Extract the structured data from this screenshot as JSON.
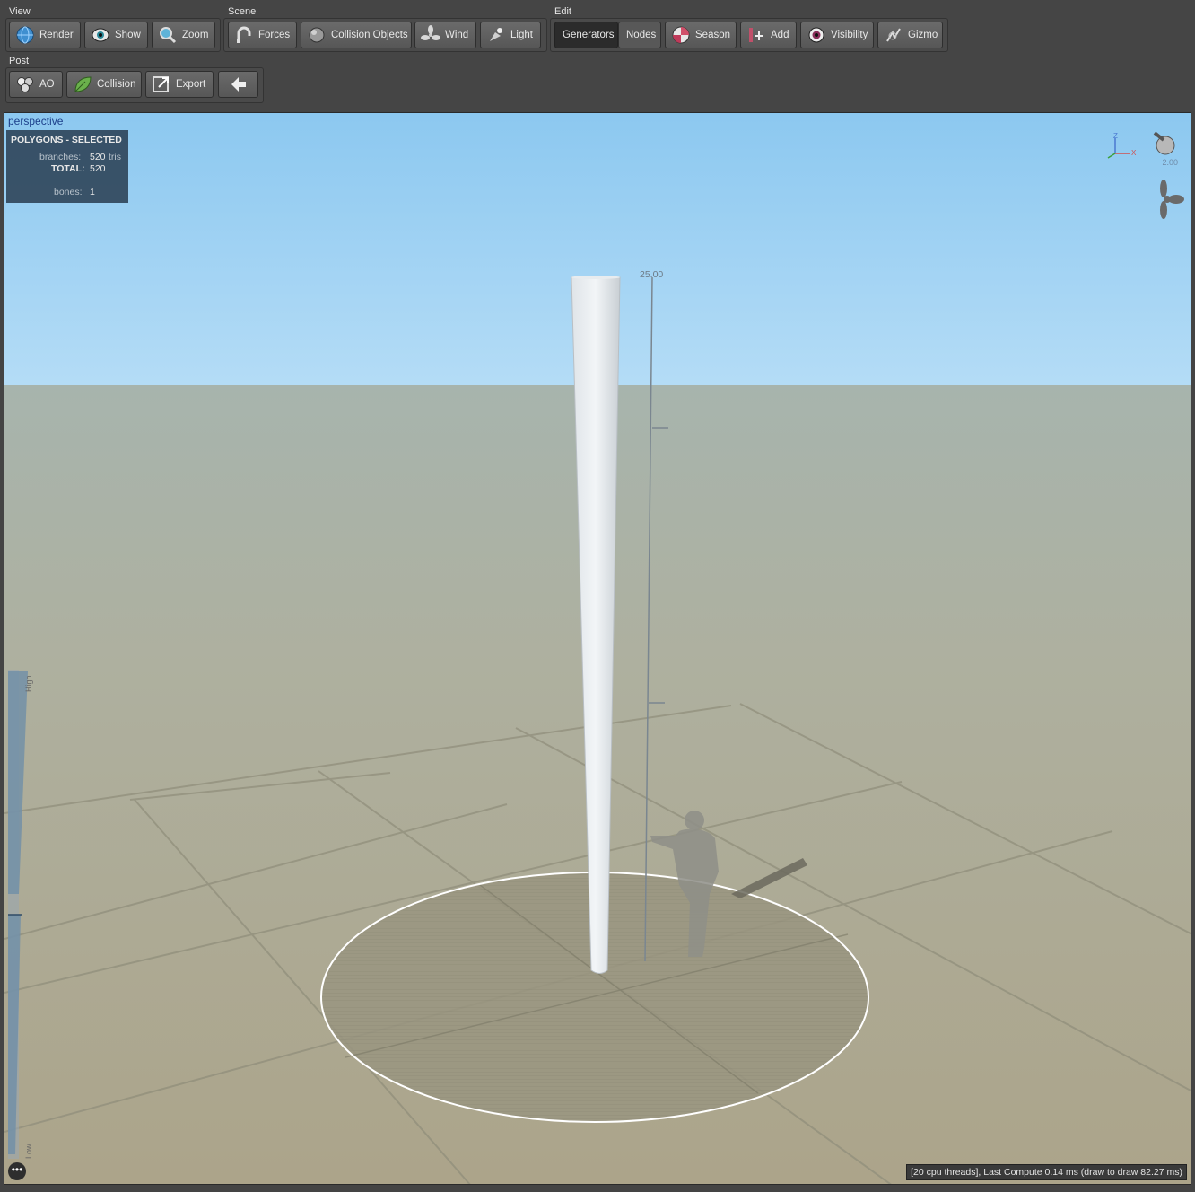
{
  "toolbar": {
    "view": {
      "label": "View",
      "buttons": [
        {
          "label": "Render",
          "icon": "globe-icon"
        },
        {
          "label": "Show",
          "icon": "eye-icon"
        },
        {
          "label": "Zoom",
          "icon": "magnifier-icon"
        }
      ]
    },
    "scene": {
      "label": "Scene",
      "buttons": [
        {
          "label": "Forces",
          "icon": "magnet-icon"
        },
        {
          "label": "Collision Objects",
          "icon": "sphere-icon"
        },
        {
          "label": "Wind",
          "icon": "fan-icon"
        },
        {
          "label": "Light",
          "icon": "lamp-icon"
        }
      ]
    },
    "edit": {
      "label": "Edit",
      "buttons": [
        {
          "label": "Generators",
          "icon": ""
        },
        {
          "label": "Nodes",
          "icon": ""
        },
        {
          "label": "Season",
          "icon": "season-icon"
        },
        {
          "label": "Add",
          "icon": "add-icon"
        },
        {
          "label": "Visibility",
          "icon": "visibility-eye-icon"
        },
        {
          "label": "Gizmo",
          "icon": "gizmo-icon"
        }
      ]
    },
    "post": {
      "label": "Post",
      "buttons": [
        {
          "label": "AO",
          "icon": "ao-icon"
        },
        {
          "label": "Collision",
          "icon": "leaf-icon"
        },
        {
          "label": "Export",
          "icon": "export-icon"
        },
        {
          "label": "",
          "icon": "back-arrow-icon"
        }
      ]
    }
  },
  "viewport": {
    "mode": "perspective",
    "stats": {
      "title": "POLYGONS - SELECTED",
      "branches_key": "branches:",
      "branches_val": "520",
      "branches_unit": "tris",
      "total_key": "TOTAL:",
      "total_val": "520",
      "bones_key": "bones:",
      "bones_val": "1"
    },
    "ruler_label": "25.00",
    "gizmo_value": "2.00",
    "axis_z": "Z",
    "axis_x": "X",
    "lod_high": "High",
    "lod_low": "Low",
    "more": "•••",
    "status": "[20 cpu threads], Last Compute 0.14 ms (draw to draw 82.27 ms)"
  },
  "colors": {
    "sky_top": "#8cc8f0",
    "sky_horizon": "#b4dcf6",
    "ground_far": "#a7b4ad",
    "ground_near": "#aca48a"
  }
}
